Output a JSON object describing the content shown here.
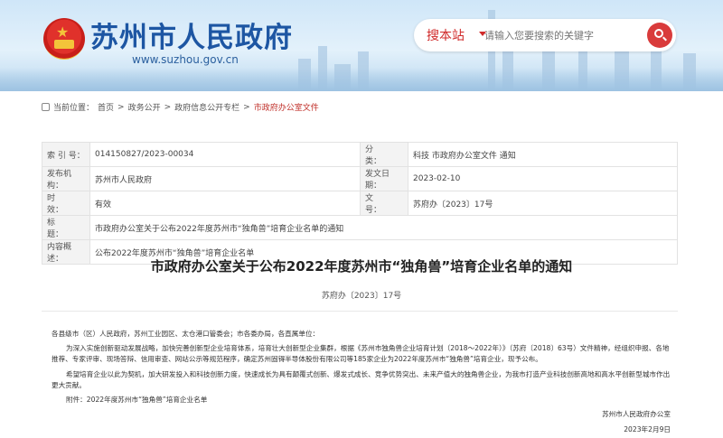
{
  "header": {
    "site_title": "苏州市人民政府",
    "site_url": "www.suzhou.gov.cn",
    "search_label": "搜本站",
    "search_placeholder": "请输入您要搜索的关键字"
  },
  "breadcrumb": {
    "prefix": "当前位置：",
    "items": [
      "首页",
      "政务公开",
      "政府信息公开专栏",
      "市政府办公室文件"
    ],
    "separator": ">"
  },
  "meta": {
    "index_label": "索 引 号：",
    "index_value": "014150827/2023-00034",
    "category_label": "分　　类：",
    "category_value": "科技 市政府办公室文件 通知",
    "issuer_label": "发布机构：",
    "issuer_value": "苏州市人民政府",
    "date_label": "发文日期：",
    "date_value": "2023-02-10",
    "validity_label": "时　　效：",
    "validity_value": "有效",
    "docno_label": "文　　号：",
    "docno_value": "苏府办〔2023〕17号",
    "title_label": "标　　题：",
    "title_value": "市政府办公室关于公布2022年度苏州市“独角兽”培育企业名单的通知",
    "summary_label": "内容概述：",
    "summary_value": "公布2022年度苏州市“独角兽”培育企业名单"
  },
  "document": {
    "title": "市政府办公室关于公布2022年度苏州市“独角兽”培育企业名单的通知",
    "doc_no": "苏府办〔2023〕17号",
    "salutation": "各县级市（区）人民政府，苏州工业园区、太仓港口管委会；市各委办局，各直属单位：",
    "para1": "为深入实施创新驱动发展战略，加快完善创新型企业培育体系，培育壮大创新型企业集群，根据《苏州市独角兽企业培育计划（2018～2022年）》（苏府〔2018〕63号）文件精神，经组织申报、各地推荐、专家评审、现场答辩、信用审查、网站公示等规范程序，确定苏州固锝半导体股份有限公司等185家企业为2022年度苏州市“独角兽”培育企业，现予公布。",
    "para2": "希望培育企业以此为契机，加大研发投入和科技创新力度，快速成长为具有颠覆式创新、爆发式成长、竞争优势突出、未来产值大的独角兽企业，为我市打造产业科技创新高地和高水平创新型城市作出更大贡献。",
    "attachment": "附件：2022年度苏州市“独角兽”培育企业名单",
    "signer": "苏州市人民政府办公室",
    "sign_date": "2023年2月9日"
  },
  "colors": {
    "brand_blue": "#1d56a3",
    "accent_red": "#d93b3b"
  }
}
